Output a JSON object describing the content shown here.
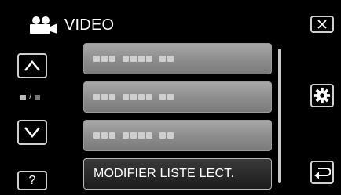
{
  "header": {
    "title": "VIDEO",
    "icon": "video-camera-icon"
  },
  "navigation": {
    "up_icon": "chevron-up-icon",
    "down_icon": "chevron-down-icon",
    "page_separator": "/"
  },
  "buttons": {
    "close_icon": "close-icon",
    "settings_icon": "gear-icon",
    "back_icon": "back-arrow-icon",
    "help_label": "?"
  },
  "list": {
    "items": [
      {
        "type": "placeholder"
      },
      {
        "type": "placeholder"
      },
      {
        "type": "placeholder"
      },
      {
        "type": "text",
        "label": "MODIFIER LISTE LECT."
      }
    ]
  },
  "colors": {
    "background": "#000000",
    "item_fill": "#8e8e8e",
    "button_border": "#cfcfcf",
    "text": "#ffffff"
  }
}
